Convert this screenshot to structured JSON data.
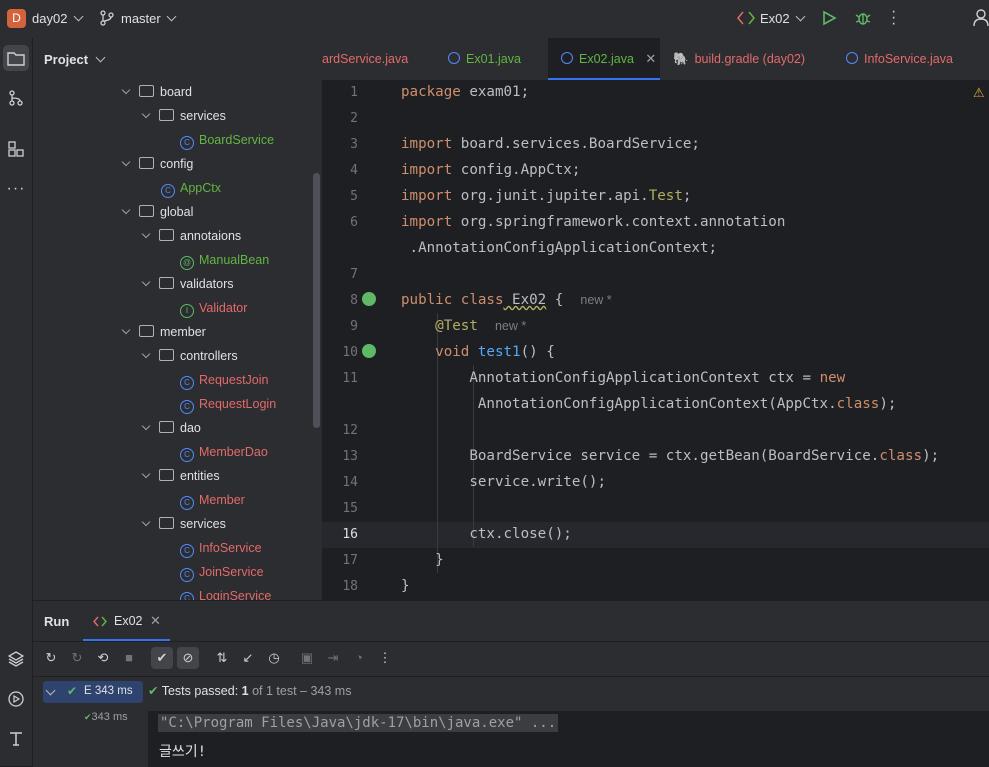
{
  "titlebar": {
    "project_badge": "D",
    "project_name": "day02",
    "branch": "master",
    "run_config": "Ex02"
  },
  "project_panel": {
    "title": "Project",
    "tree": [
      {
        "label": "board",
        "kind": "folder",
        "indent": 0
      },
      {
        "label": "services",
        "kind": "folder",
        "indent": 1
      },
      {
        "label": "BoardService",
        "kind": "class",
        "indent": 2,
        "color": "#62b543"
      },
      {
        "label": "config",
        "kind": "folder",
        "indent": 0
      },
      {
        "label": "AppCtx",
        "kind": "class",
        "indent": 1,
        "color": "#62b543"
      },
      {
        "label": "global",
        "kind": "folder",
        "indent": 0
      },
      {
        "label": "annotaions",
        "kind": "folder",
        "indent": 1
      },
      {
        "label": "ManualBean",
        "kind": "annotation",
        "indent": 2,
        "color": "#62b543"
      },
      {
        "label": "validators",
        "kind": "folder",
        "indent": 1
      },
      {
        "label": "Validator",
        "kind": "interface",
        "indent": 2,
        "color": "#e46a6a"
      },
      {
        "label": "member",
        "kind": "folder",
        "indent": 0
      },
      {
        "label": "controllers",
        "kind": "folder",
        "indent": 1
      },
      {
        "label": "RequestJoin",
        "kind": "class",
        "indent": 2,
        "color": "#e46a6a"
      },
      {
        "label": "RequestLogin",
        "kind": "class",
        "indent": 2,
        "color": "#e46a6a"
      },
      {
        "label": "dao",
        "kind": "folder",
        "indent": 1
      },
      {
        "label": "MemberDao",
        "kind": "class",
        "indent": 2,
        "color": "#e46a6a"
      },
      {
        "label": "entities",
        "kind": "folder",
        "indent": 1
      },
      {
        "label": "Member",
        "kind": "class",
        "indent": 2,
        "color": "#e46a6a"
      },
      {
        "label": "services",
        "kind": "folder",
        "indent": 1
      },
      {
        "label": "InfoService",
        "kind": "class",
        "indent": 2,
        "color": "#e46a6a"
      },
      {
        "label": "JoinService",
        "kind": "class",
        "indent": 2,
        "color": "#e46a6a"
      },
      {
        "label": "LoginService",
        "kind": "class",
        "indent": 2,
        "color": "#e46a6a"
      }
    ]
  },
  "tabs": [
    {
      "label": "ardService.java",
      "color": "#e46a6a",
      "active": false,
      "closable": false
    },
    {
      "label": "Ex01.java",
      "color": "#62b543",
      "active": false,
      "closable": false
    },
    {
      "label": "Ex02.java",
      "color": "#62b543",
      "active": true,
      "closable": true
    },
    {
      "label": "build.gradle (day02)",
      "color": "#e46a6a",
      "active": false,
      "closable": false
    },
    {
      "label": "InfoService.java",
      "color": "#e46a6a",
      "active": false,
      "closable": false
    }
  ],
  "editor": {
    "line_numbers": [
      "1",
      "2",
      "3",
      "4",
      "5",
      "6",
      "",
      "7",
      "8",
      "9",
      "10",
      "11",
      "",
      "12",
      "13",
      "14",
      "15",
      "16",
      "17",
      "18"
    ],
    "lines": {
      "l1_kw": "package",
      "l1_rest": " exam01;",
      "l3_kw": "import",
      "l3_rest": " board.services.BoardService;",
      "l4_kw": "import",
      "l4_rest": " config.AppCtx;",
      "l5_kw": "import",
      "l5_rest": " org.junit.jupiter.api.",
      "l5_an": "Test",
      "l5_end": ";",
      "l6_kw": "import",
      "l6_rest": " org.springframework.context.annotation",
      "l6b": " .AnnotationConfigApplicationContext;",
      "l8_kw": "public class",
      "l8_name": " Ex02",
      "l8_rest": " {",
      "l8_hint": "new *",
      "l9_an": "@Test",
      "l9_hint": "new *",
      "l10_kw": "void",
      "l10_fn": " test1",
      "l10_rest": "() {",
      "l11_rest": "AnnotationConfigApplicationContext ctx = ",
      "l11_kw": "new",
      "l11b_rest": " AnnotationConfigApplicationContext(AppCtx.",
      "l11b_kw": "class",
      "l11b_end": ");",
      "l13_rest": "BoardService service = ctx.getBean(BoardService.",
      "l13_kw": "class",
      "l13_end": ");",
      "l14": "service.write();",
      "l16": "ctx.close();",
      "l17": "}",
      "l18": "}"
    }
  },
  "run_panel": {
    "title": "Run",
    "tab_label": "Ex02",
    "tree_root": "E 343 ms",
    "tree_child": "343 ms",
    "status_prefix": "Tests passed:",
    "status_passed": "1",
    "status_suffix": "of 1 test – 343 ms",
    "console_cmd": "\"C:\\Program Files\\Java\\jdk-17\\bin\\java.exe\" ...",
    "console_output": "글쓰기!"
  }
}
